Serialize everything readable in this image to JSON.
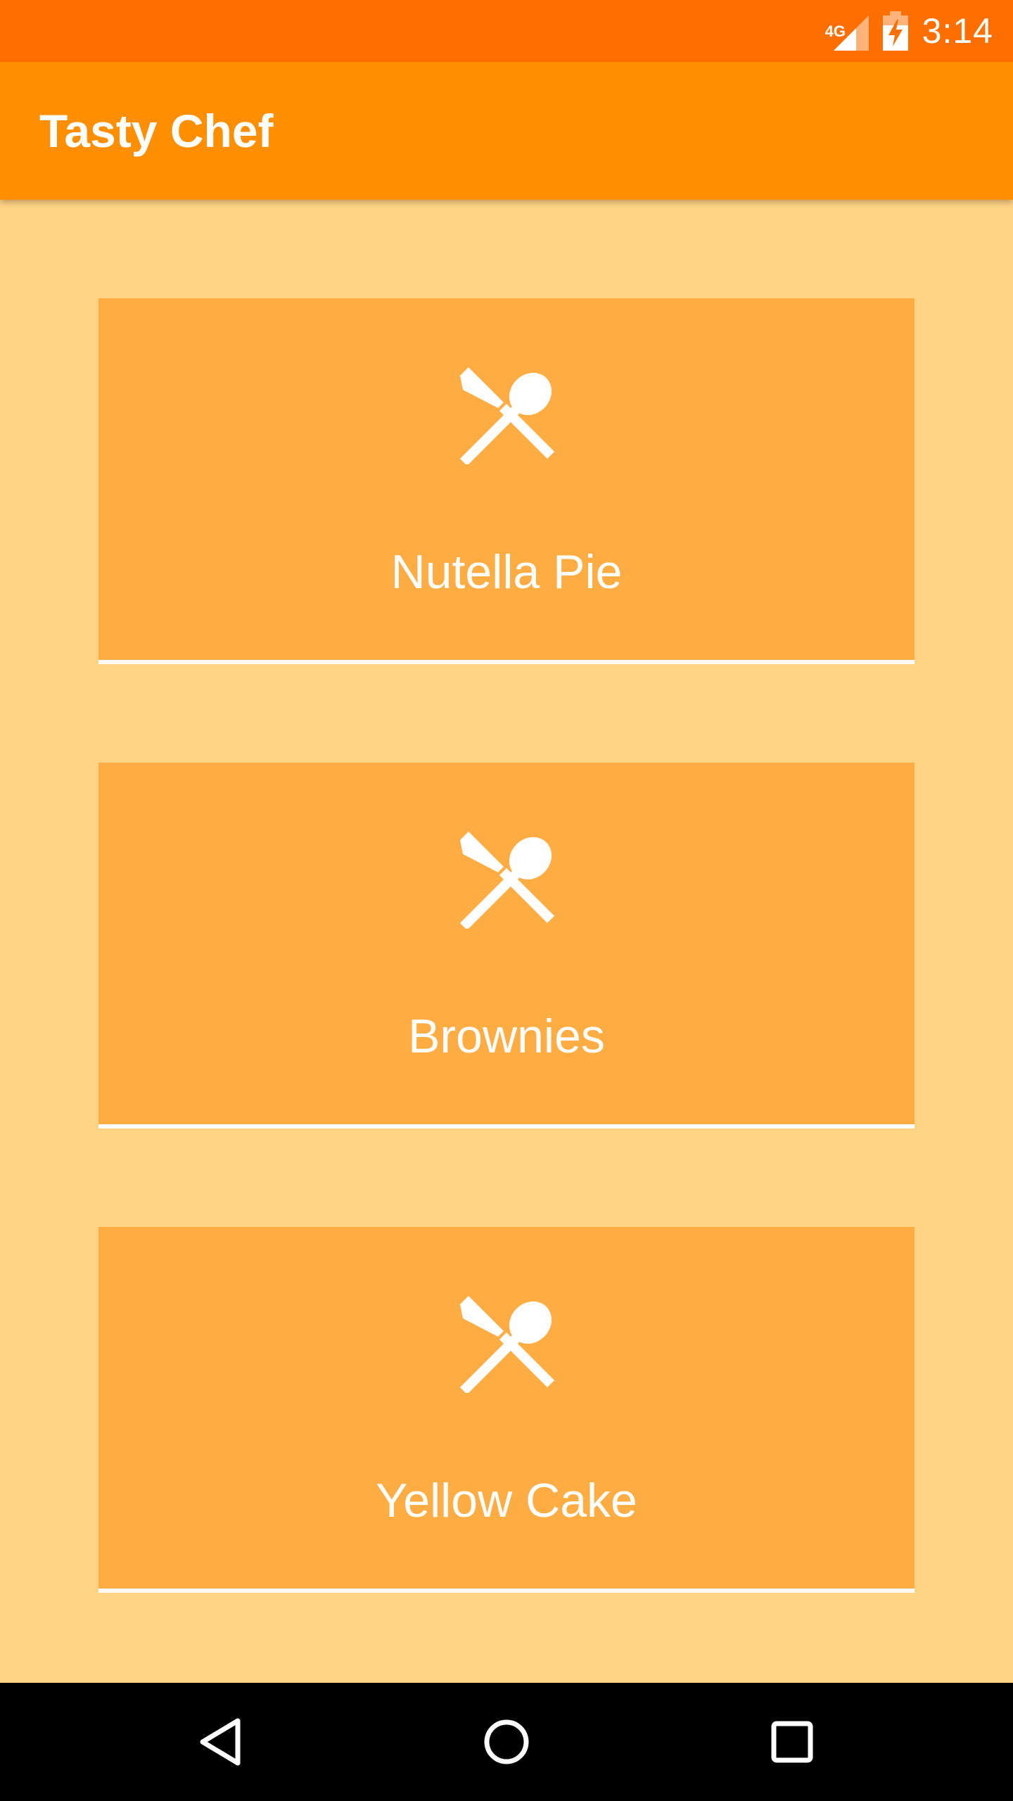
{
  "status_bar": {
    "network_type": "4G",
    "time": "3:14",
    "icons": [
      "signal-icon",
      "battery-charging-icon"
    ]
  },
  "app_bar": {
    "title": "Tasty Chef"
  },
  "recipes": [
    {
      "label": "Nutella Pie",
      "icon": "utensils-icon"
    },
    {
      "label": "Brownies",
      "icon": "utensils-icon"
    },
    {
      "label": "Yellow Cake",
      "icon": "utensils-icon"
    }
  ],
  "nav_bar": {
    "buttons": [
      "back-icon",
      "home-icon",
      "recents-icon"
    ]
  },
  "colors": {
    "status_bar": "#FF6F00",
    "app_bar": "#FF8F00",
    "background": "#FFD384",
    "card": "#FFAD42",
    "text": "#FFFFFF"
  }
}
